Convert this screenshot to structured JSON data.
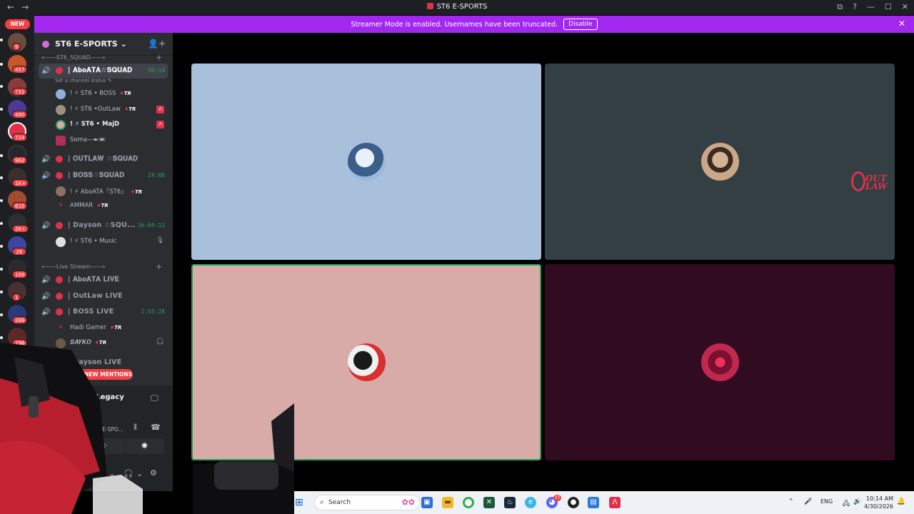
{
  "window": {
    "title": "ST6 E-SPORTS",
    "nav": [
      "←",
      "→"
    ],
    "controls": [
      "⧉",
      "?",
      "—",
      "☐",
      "✕"
    ]
  },
  "banner": {
    "text": "Streamer Mode is enabled. Usernames have been truncated.",
    "button": "Disable",
    "close": "✕"
  },
  "guilds": {
    "new_label": "NEW",
    "badges": [
      "9",
      "457",
      "731",
      "490",
      "724",
      "962",
      "1K+",
      "610",
      "2K+",
      "26",
      "109",
      "1",
      "288",
      "796"
    ]
  },
  "server": {
    "name": "ST6 E-SPORTS",
    "chevron": "⌄",
    "add_member": "👤+"
  },
  "categories": {
    "squad": "«——ST6_SQUAD——»",
    "live": "«——Live Stream——»",
    "plus": "+"
  },
  "channels": {
    "aboata_squad": {
      "label": "| 𝐀𝐛𝐨𝐀𝐓𝐀☆𝐒𝐐𝐔𝐀𝐃",
      "time": "50:14",
      "status": "Set a channel status ✎"
    },
    "outlaw_squad": {
      "label": "| 𝐎𝐔𝐓𝐋𝐀𝐖 ☆𝐒𝐐𝐔𝐀𝐃"
    },
    "boss_squad": {
      "label": "| 𝐁𝐎𝐒𝐒☆𝐒𝐐𝐔𝐀𝐃",
      "time": "24:08"
    },
    "dayson_squad": {
      "label": "| Dayson ☆SQU...",
      "time": "16:04:11"
    },
    "aboata_live": {
      "label": "| 𝐀𝐛𝐨𝐀𝐓𝐀 𝐋𝐈𝐕𝐄"
    },
    "outlaw_live": {
      "label": "| OutLaw LIVE"
    },
    "boss_live": {
      "label": "| BOSS LIVE",
      "time": "1:55:28"
    },
    "dayson_live": {
      "label": "| Dayson LIVE"
    }
  },
  "members": {
    "boss": {
      "prefix": "! ⚡ ",
      "name": "ST6 • BOSS",
      "tag": "TR"
    },
    "outlaw": {
      "prefix": "! ⚡ ",
      "name": "ST6 •OutLaw",
      "tag": "TR",
      "icon": "Λ"
    },
    "majd": {
      "prefix": "! ⚡ ",
      "name": "ST6 • MajD",
      "icon": "Λ"
    },
    "soma": {
      "name": "Soma—➽📼"
    },
    "aboata": {
      "prefix": "! ⚡ ",
      "name": "AboATA『ST6』",
      "tag": "TR"
    },
    "ammar": {
      "name": "AMMAR",
      "tag": "TR"
    },
    "music": {
      "prefix": "! ⚡ ",
      "name": "ST6 • Music"
    },
    "hadi": {
      "name": "Hadi Gamer",
      "tag": "TR"
    },
    "sayko": {
      "name": "𝑺𝑨𝒀𝑲𝑶",
      "tag": "TR"
    }
  },
  "mentions": "37 NEW MENTIONS",
  "panel": {
    "game": "V Legacy",
    "server": "6 E-SPO..."
  },
  "tiles": [
    {
      "bg": "#a8c0dc",
      "speaking": false
    },
    {
      "bg": "#343f44",
      "speaking": false
    },
    {
      "bg": "#d8aba9",
      "speaking": true
    },
    {
      "bg": "#310b20",
      "speaking": false
    }
  ],
  "overlay_logo": {
    "line1": "OUT",
    "line2": "LAW"
  },
  "taskbar": {
    "search_placeholder": "Search",
    "lang": "ENG",
    "time": "10:14 AM",
    "date": "4/30/2026",
    "discord_badge": "37"
  },
  "colors": {
    "accent": "#a228f0",
    "brand_red": "#e0314b",
    "voice_green": "#23a55a"
  }
}
